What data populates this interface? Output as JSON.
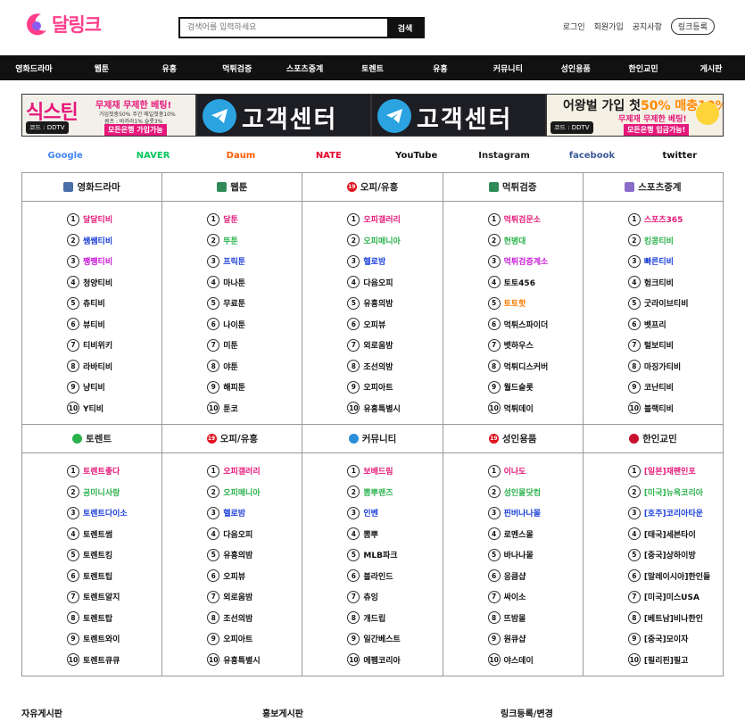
{
  "header": {
    "logo_text": "달링크",
    "search_placeholder": "검색어를 입력하세요",
    "search_button": "검색",
    "links": [
      "로그인",
      "회원가입",
      "공지사항"
    ],
    "register_button": "링크등록"
  },
  "nav": [
    "영화드라마",
    "웹툰",
    "유흥",
    "먹튀검증",
    "스포츠중계",
    "토렌트",
    "유흥",
    "커뮤니티",
    "성인용품",
    "한인교민",
    "게시판"
  ],
  "banners": {
    "b1": {
      "big": "식스틴",
      "tag": "무제재 무제한 베팅!",
      "sub": "가입첫충50% 주간 매일첫충10%",
      "sub2": "콤프 : 바카라1% 슬롯3%",
      "code": "코드 : DDTV",
      "all": "모든은행 가입가능"
    },
    "b2": {
      "text": "고객센터"
    },
    "b3": {
      "text": "고객센터"
    },
    "b4": {
      "big_pre": "어왕벌 가입 첫",
      "big_hl": "50% 매충10%",
      "sub": "무제재 무제한 베팅!",
      "code": "코드 : DDTV",
      "all": "모든은행 입금가능!"
    }
  },
  "brands": [
    {
      "name": "Google",
      "color": "#4285f4"
    },
    {
      "name": "NAVER",
      "color": "#03c75a"
    },
    {
      "name": "Daum",
      "color": "#ff5a00"
    },
    {
      "name": "NATE",
      "color": "#e4002b"
    },
    {
      "name": "YouTube",
      "color": "#111111"
    },
    {
      "name": "Instagram",
      "color": "#222222"
    },
    {
      "name": "facebook",
      "color": "#3b5998"
    },
    {
      "name": "twitter",
      "color": "#111111"
    }
  ],
  "rows": [
    [
      {
        "title": "영화드라마",
        "icon": "film-icon",
        "icon_color": "#4a6ea8",
        "items": [
          {
            "t": "달달티비",
            "c": "#e6187a"
          },
          {
            "t": "쌤쌤티비",
            "c": "#1a3fd8"
          },
          {
            "t": "쨍쨍티비",
            "c": "#c81ad8"
          },
          {
            "t": "청양티비",
            "c": "#111"
          },
          {
            "t": "츄티비",
            "c": "#111"
          },
          {
            "t": "뷰티비",
            "c": "#111"
          },
          {
            "t": "티비위키",
            "c": "#111"
          },
          {
            "t": "라바티비",
            "c": "#111"
          },
          {
            "t": "냥티비",
            "c": "#111"
          },
          {
            "t": "Y티비",
            "c": "#111"
          }
        ]
      },
      {
        "title": "웹툰",
        "icon": "book-icon",
        "icon_color": "#2e8b57",
        "items": [
          {
            "t": "달툰",
            "c": "#e6187a"
          },
          {
            "t": "뚜툰",
            "c": "#2bb24c"
          },
          {
            "t": "프릭툰",
            "c": "#1a3fd8"
          },
          {
            "t": "마나툰",
            "c": "#111"
          },
          {
            "t": "무료툰",
            "c": "#111"
          },
          {
            "t": "나이툰",
            "c": "#111"
          },
          {
            "t": "미툰",
            "c": "#111"
          },
          {
            "t": "야툰",
            "c": "#111"
          },
          {
            "t": "해피툰",
            "c": "#111"
          },
          {
            "t": "툰코",
            "c": "#111"
          }
        ]
      },
      {
        "title": "오피/유흥",
        "icon": "adult-19-icon",
        "icon_color": "#e0141e",
        "items": [
          {
            "t": "오피갤러리",
            "c": "#e6187a"
          },
          {
            "t": "오피매니아",
            "c": "#2bb24c"
          },
          {
            "t": "헬로밤",
            "c": "#1a3fd8"
          },
          {
            "t": "다음오피",
            "c": "#111"
          },
          {
            "t": "유흥의밤",
            "c": "#111"
          },
          {
            "t": "오피뷰",
            "c": "#111"
          },
          {
            "t": "외로움밤",
            "c": "#111"
          },
          {
            "t": "조선의밤",
            "c": "#111"
          },
          {
            "t": "오피아트",
            "c": "#111"
          },
          {
            "t": "유흥특별시",
            "c": "#111"
          }
        ]
      },
      {
        "title": "먹튀검증",
        "icon": "search-icon",
        "icon_color": "#2e8b57",
        "items": [
          {
            "t": "먹튀검문소",
            "c": "#e6187a"
          },
          {
            "t": "헌병대",
            "c": "#2bb24c"
          },
          {
            "t": "먹튀검증계소",
            "c": "#c81ad8"
          },
          {
            "t": "토토456",
            "c": "#111"
          },
          {
            "t": "토토핫",
            "c": "#ff7a00"
          },
          {
            "t": "먹튀스파이더",
            "c": "#111"
          },
          {
            "t": "뱃하우스",
            "c": "#111"
          },
          {
            "t": "먹튀디스커버",
            "c": "#111"
          },
          {
            "t": "월드슬롯",
            "c": "#111"
          },
          {
            "t": "먹튀데이",
            "c": "#111"
          }
        ]
      },
      {
        "title": "스포츠중계",
        "icon": "sports-icon",
        "icon_color": "#8a6cc8",
        "items": [
          {
            "t": "스포츠365",
            "c": "#e6187a"
          },
          {
            "t": "킹콩티비",
            "c": "#2bb24c"
          },
          {
            "t": "빠른티비",
            "c": "#1a3fd8"
          },
          {
            "t": "헝크티비",
            "c": "#111"
          },
          {
            "t": "굿라이브티비",
            "c": "#111"
          },
          {
            "t": "벳프리",
            "c": "#111"
          },
          {
            "t": "털보티비",
            "c": "#111"
          },
          {
            "t": "마징가티비",
            "c": "#111"
          },
          {
            "t": "코난티비",
            "c": "#111"
          },
          {
            "t": "블랙티비",
            "c": "#111"
          }
        ]
      }
    ],
    [
      {
        "title": "토렌트",
        "icon": "torrent-icon",
        "icon_color": "#2bb24c",
        "items": [
          {
            "t": "토렌트좋다",
            "c": "#e6187a"
          },
          {
            "t": "공미니사랑",
            "c": "#2bb24c"
          },
          {
            "t": "토렌트다이소",
            "c": "#1a3fd8"
          },
          {
            "t": "토렌트썸",
            "c": "#111"
          },
          {
            "t": "토렌트킹",
            "c": "#111"
          },
          {
            "t": "토렌트팁",
            "c": "#111"
          },
          {
            "t": "토렌트알지",
            "c": "#111"
          },
          {
            "t": "토렌트탑",
            "c": "#111"
          },
          {
            "t": "토렌트와이",
            "c": "#111"
          },
          {
            "t": "토렌트큐큐",
            "c": "#111"
          }
        ]
      },
      {
        "title": "오피/유흥",
        "icon": "adult-19-icon",
        "icon_color": "#e0141e",
        "items": [
          {
            "t": "오피갤러리",
            "c": "#e6187a"
          },
          {
            "t": "오피매니아",
            "c": "#2bb24c"
          },
          {
            "t": "헬로밤",
            "c": "#1a3fd8"
          },
          {
            "t": "다음오피",
            "c": "#111"
          },
          {
            "t": "유흥의밤",
            "c": "#111"
          },
          {
            "t": "오피뷰",
            "c": "#111"
          },
          {
            "t": "외로움밤",
            "c": "#111"
          },
          {
            "t": "조선의밤",
            "c": "#111"
          },
          {
            "t": "오피아트",
            "c": "#111"
          },
          {
            "t": "유흥특별시",
            "c": "#111"
          }
        ]
      },
      {
        "title": "커뮤니티",
        "icon": "chat-icon",
        "icon_color": "#2a8fd8",
        "items": [
          {
            "t": "보배드림",
            "c": "#e6187a"
          },
          {
            "t": "뽐뿌랜즈",
            "c": "#2bb24c"
          },
          {
            "t": "인벤",
            "c": "#1a3fd8"
          },
          {
            "t": "뽐뿌",
            "c": "#111"
          },
          {
            "t": "MLB파크",
            "c": "#111"
          },
          {
            "t": "블라인드",
            "c": "#111"
          },
          {
            "t": "츄잉",
            "c": "#111"
          },
          {
            "t": "개드립",
            "c": "#111"
          },
          {
            "t": "일간베스트",
            "c": "#111"
          },
          {
            "t": "에펨코리아",
            "c": "#111"
          }
        ]
      },
      {
        "title": "성인용품",
        "icon": "adult-19-icon",
        "icon_color": "#e0141e",
        "items": [
          {
            "t": "이나도",
            "c": "#e6187a"
          },
          {
            "t": "성인몰닷컴",
            "c": "#2bb24c"
          },
          {
            "t": "핀버나나몰",
            "c": "#1a3fd8"
          },
          {
            "t": "로멘스몰",
            "c": "#111"
          },
          {
            "t": "바나나몰",
            "c": "#111"
          },
          {
            "t": "응큼샵",
            "c": "#111"
          },
          {
            "t": "싸이소",
            "c": "#111"
          },
          {
            "t": "뜨밤몰",
            "c": "#111"
          },
          {
            "t": "원큐샵",
            "c": "#111"
          },
          {
            "t": "야스데이",
            "c": "#111"
          }
        ]
      },
      {
        "title": "한인교민",
        "icon": "korea-flag-icon",
        "icon_color": "#c8102e",
        "items": [
          {
            "t": "[일본]재팬인포",
            "c": "#e6187a"
          },
          {
            "t": "[미국]뉴욕코리아",
            "c": "#2bb24c"
          },
          {
            "t": "[호주]코리아타운",
            "c": "#1a3fd8"
          },
          {
            "t": "[태국]세븐타이",
            "c": "#111"
          },
          {
            "t": "[중국]상하이방",
            "c": "#111"
          },
          {
            "t": "[말레이시아]한인들",
            "c": "#111"
          },
          {
            "t": "[미국]미스USA",
            "c": "#111"
          },
          {
            "t": "[베트남]비나한인",
            "c": "#111"
          },
          {
            "t": "[중국]모이자",
            "c": "#111"
          },
          {
            "t": "[필리핀]필고",
            "c": "#111"
          }
        ]
      }
    ]
  ],
  "footer": [
    "자유게시판",
    "홍보게시판",
    "링크등록/변경"
  ]
}
